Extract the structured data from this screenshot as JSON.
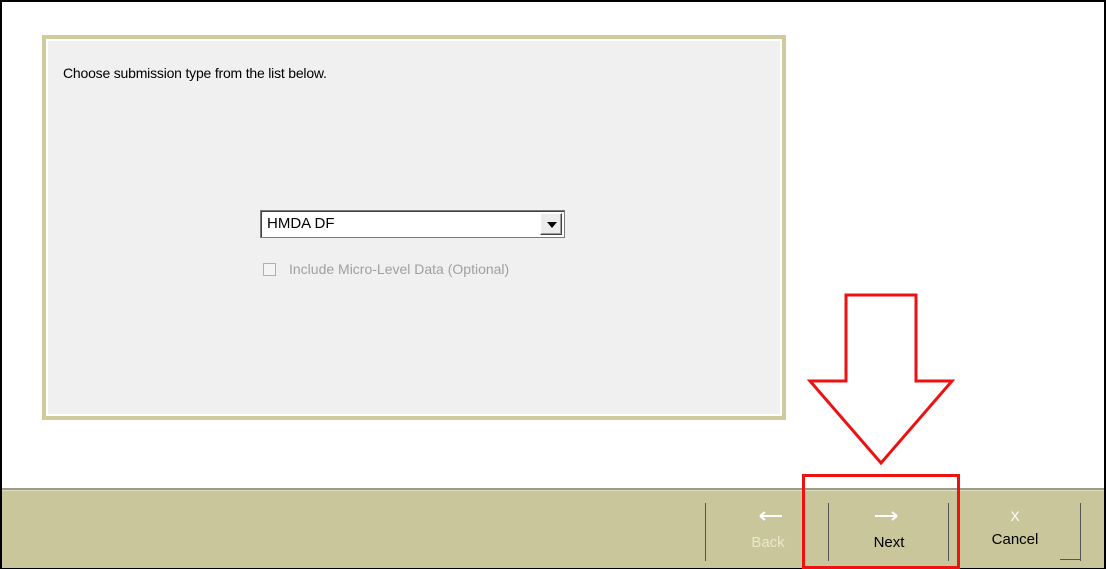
{
  "panel": {
    "instruction": "Choose submission type from the list below.",
    "submission_type": {
      "selected": "HMDA DF"
    },
    "micro_level": {
      "label": "Include Micro-Level Data (Optional)",
      "checked": false,
      "enabled": false
    }
  },
  "toolbar": {
    "back_label": "Back",
    "next_label": "Next",
    "cancel_glyph": "X",
    "cancel_label": "Cancel"
  },
  "colors": {
    "highlight": "#ee1111",
    "toolbar_bg": "#c8c69a",
    "panel_border": "#cfcb9d"
  },
  "icons": [
    "left-arrow-icon",
    "right-arrow-icon",
    "dropdown-arrow-icon",
    "annotation-down-arrow"
  ]
}
